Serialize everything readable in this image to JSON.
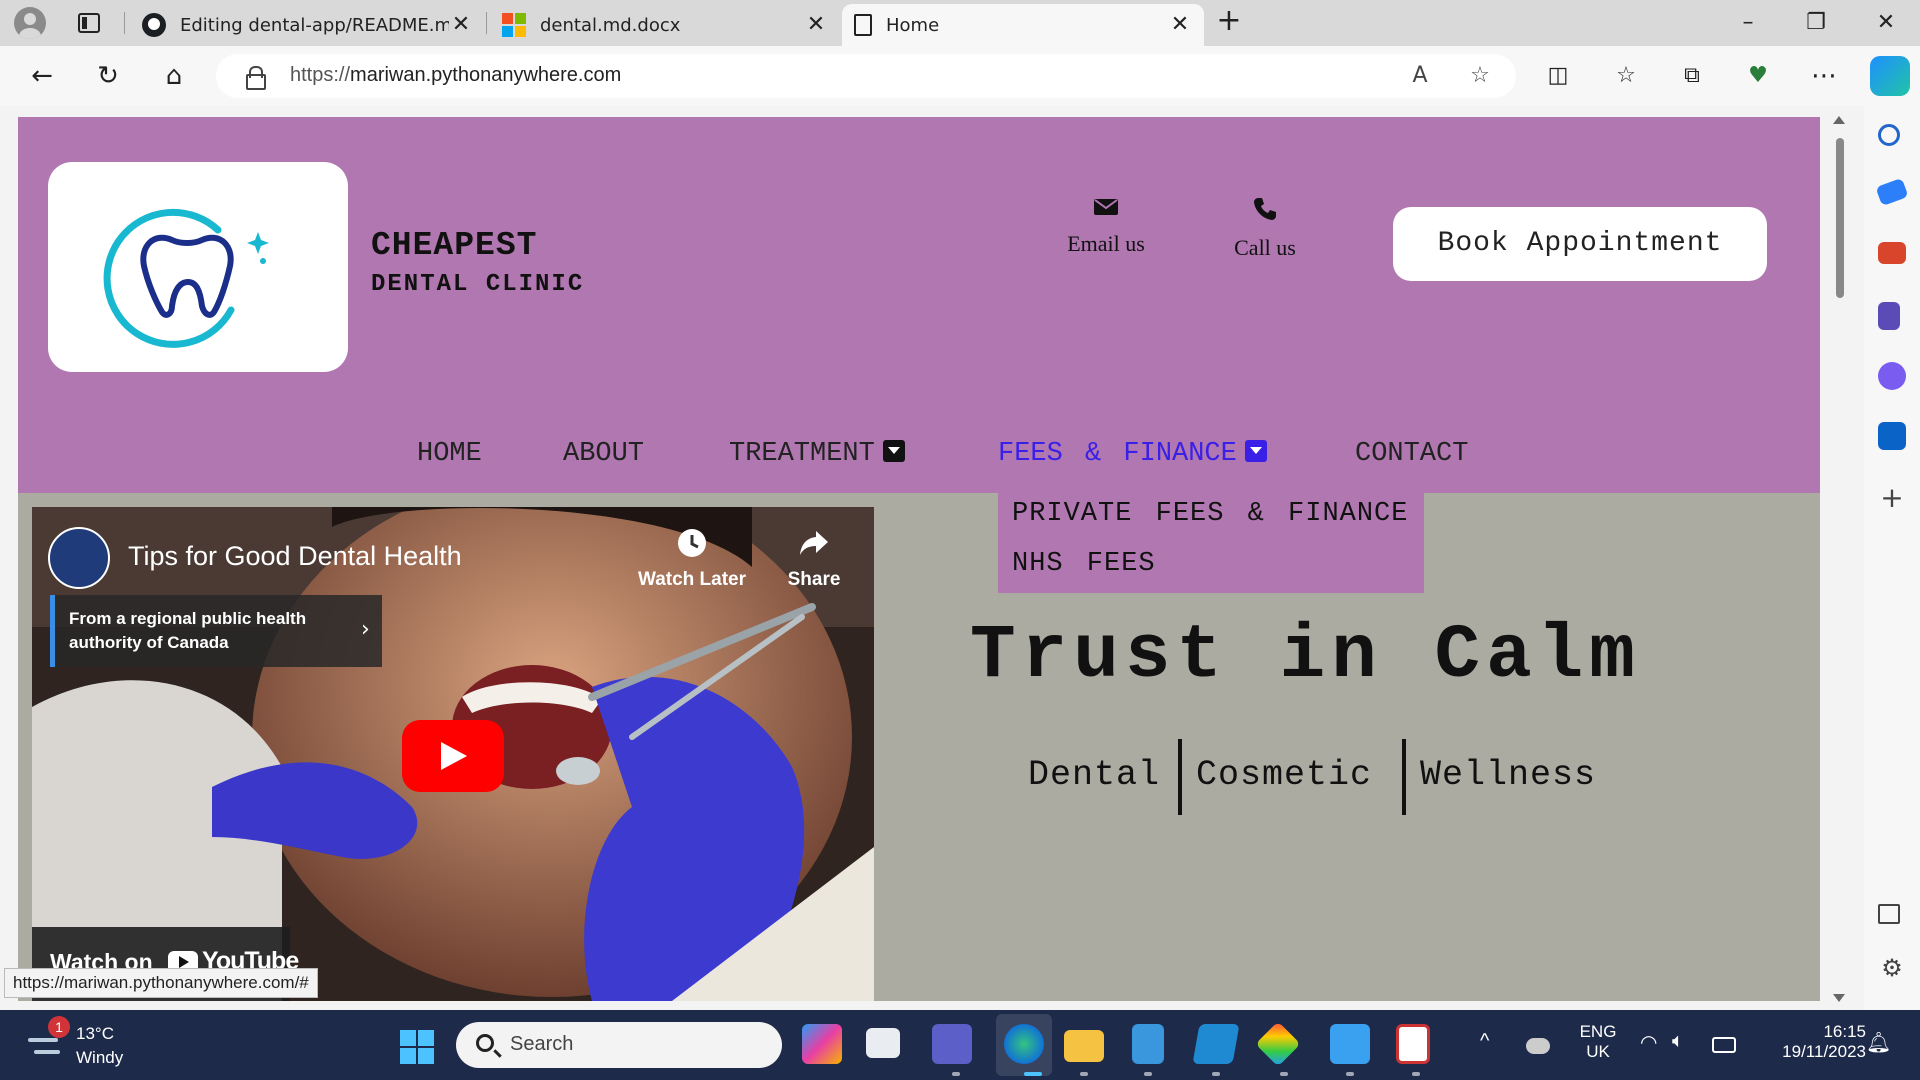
{
  "browser": {
    "tabs": [
      {
        "title": "Editing dental-app/README.md",
        "icon": "github-icon",
        "active": false
      },
      {
        "title": "dental.md.docx",
        "icon": "microsoft-icon",
        "active": false
      },
      {
        "title": "Home",
        "icon": "page-icon",
        "active": true
      }
    ],
    "url_scheme": "https://",
    "url_host": "mariwan.pythonanywhere.com",
    "status_url": "https://mariwan.pythonanywhere.com/#"
  },
  "site": {
    "brand_title": "CHEAPEST",
    "brand_subtitle": "DENTAL CLINIC",
    "email_label": "Email us",
    "call_label": "Call us",
    "book_label": "Book Appointment",
    "nav": [
      {
        "label": "HOME"
      },
      {
        "label": "ABOUT"
      },
      {
        "label": "TREATMENT"
      },
      {
        "label": "FEES & FINANCE"
      },
      {
        "label": "CONTACT"
      }
    ],
    "dropdown": [
      "PRIVATE FEES & FINANCE",
      "NHS FEES"
    ],
    "hero_title": "Trust in Calm",
    "hero_tags": [
      "Dental",
      "Cosmetic",
      "Wellness"
    ],
    "colors": {
      "header": "#b077b0",
      "body": "#ababa2",
      "active_nav": "#3a20e6"
    }
  },
  "video": {
    "title": "Tips for Good Dental Health",
    "info_card": "From a regional public health authority of Canada",
    "watch_later": "Watch Later",
    "share": "Share",
    "watch_on": "Watch on",
    "youtube": "YouTube"
  },
  "taskbar": {
    "temp": "13°C",
    "weather": "Windy",
    "weather_badge": "1",
    "search_placeholder": "Search",
    "lang_top": "ENG",
    "lang_bottom": "UK",
    "time": "16:15",
    "date": "19/11/2023"
  }
}
